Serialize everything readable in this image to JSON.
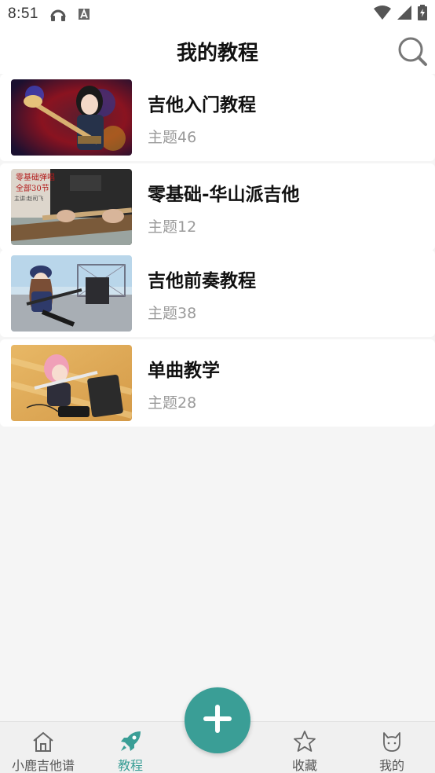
{
  "status_bar": {
    "time": "8:51"
  },
  "header": {
    "title": "我的教程",
    "search_icon": "search-icon"
  },
  "courses": [
    {
      "title": "吉他入门教程",
      "subtitle": "主题46",
      "thumb": "anime-girl-bass-guitar"
    },
    {
      "title": "零基础-华山派吉他",
      "subtitle": "主题12",
      "thumb": "guitar-lesson-photo",
      "thumb_text": [
        "零基础弹唱",
        "全部30节",
        "主讲:赵司飞"
      ]
    },
    {
      "title": "吉他前奏教程",
      "subtitle": "主题38",
      "thumb": "anime-girl-rooftop"
    },
    {
      "title": "单曲教学",
      "subtitle": "主题28",
      "thumb": "anime-girl-amp"
    }
  ],
  "bottom_nav": {
    "items": [
      {
        "label": "小鹿吉他谱",
        "icon": "home-icon"
      },
      {
        "label": "教程",
        "icon": "rocket-icon",
        "active": true
      },
      {
        "label": "收藏",
        "icon": "star-icon"
      },
      {
        "label": "我的",
        "icon": "cat-icon"
      }
    ],
    "fab_icon": "plus-icon"
  },
  "colors": {
    "accent": "#3a9e96",
    "background": "#f5f5f5",
    "subtitle": "#9a9a9a"
  }
}
